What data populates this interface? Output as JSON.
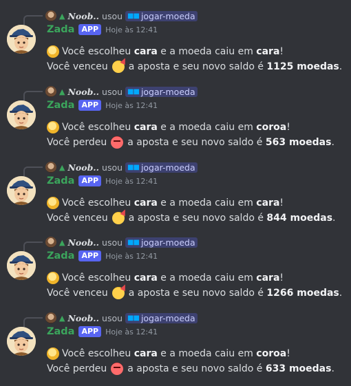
{
  "common": {
    "reply_user": "Noob..",
    "used_text": "usou",
    "command": "jogar-moeda",
    "username": "Zada",
    "app_badge": "APP",
    "timestamp": "Hoje às 12:41",
    "line1_prefix": "Você escolheu",
    "line1_mid": "e a moeda caiu em",
    "line1_end": "!",
    "line2_mid": "a aposta e seu novo saldo é",
    "line2_end": "."
  },
  "messages": [
    {
      "choice": "cara",
      "result": "cara",
      "outcome": "Você venceu",
      "balance": "1125 moedas"
    },
    {
      "choice": "cara",
      "result": "coroa",
      "outcome": "Você perdeu",
      "balance": "563 moedas"
    },
    {
      "choice": "cara",
      "result": "cara",
      "outcome": "Você venceu",
      "balance": "844 moedas"
    },
    {
      "choice": "cara",
      "result": "cara",
      "outcome": "Você venceu",
      "balance": "1266 moedas"
    },
    {
      "choice": "cara",
      "result": "coroa",
      "outcome": "Você perdeu",
      "balance": "633 moedas"
    }
  ],
  "icons": {
    "coin": "coin-emoji-icon",
    "win": "partying-face-icon",
    "lose": "angry-face-icon",
    "command": "app-command-icon",
    "tree": "evergreen-tree-icon"
  },
  "colors": {
    "background": "#313338",
    "username": "#3ba55c",
    "app_badge": "#5865f2",
    "command_text": "#c9cdfb"
  }
}
